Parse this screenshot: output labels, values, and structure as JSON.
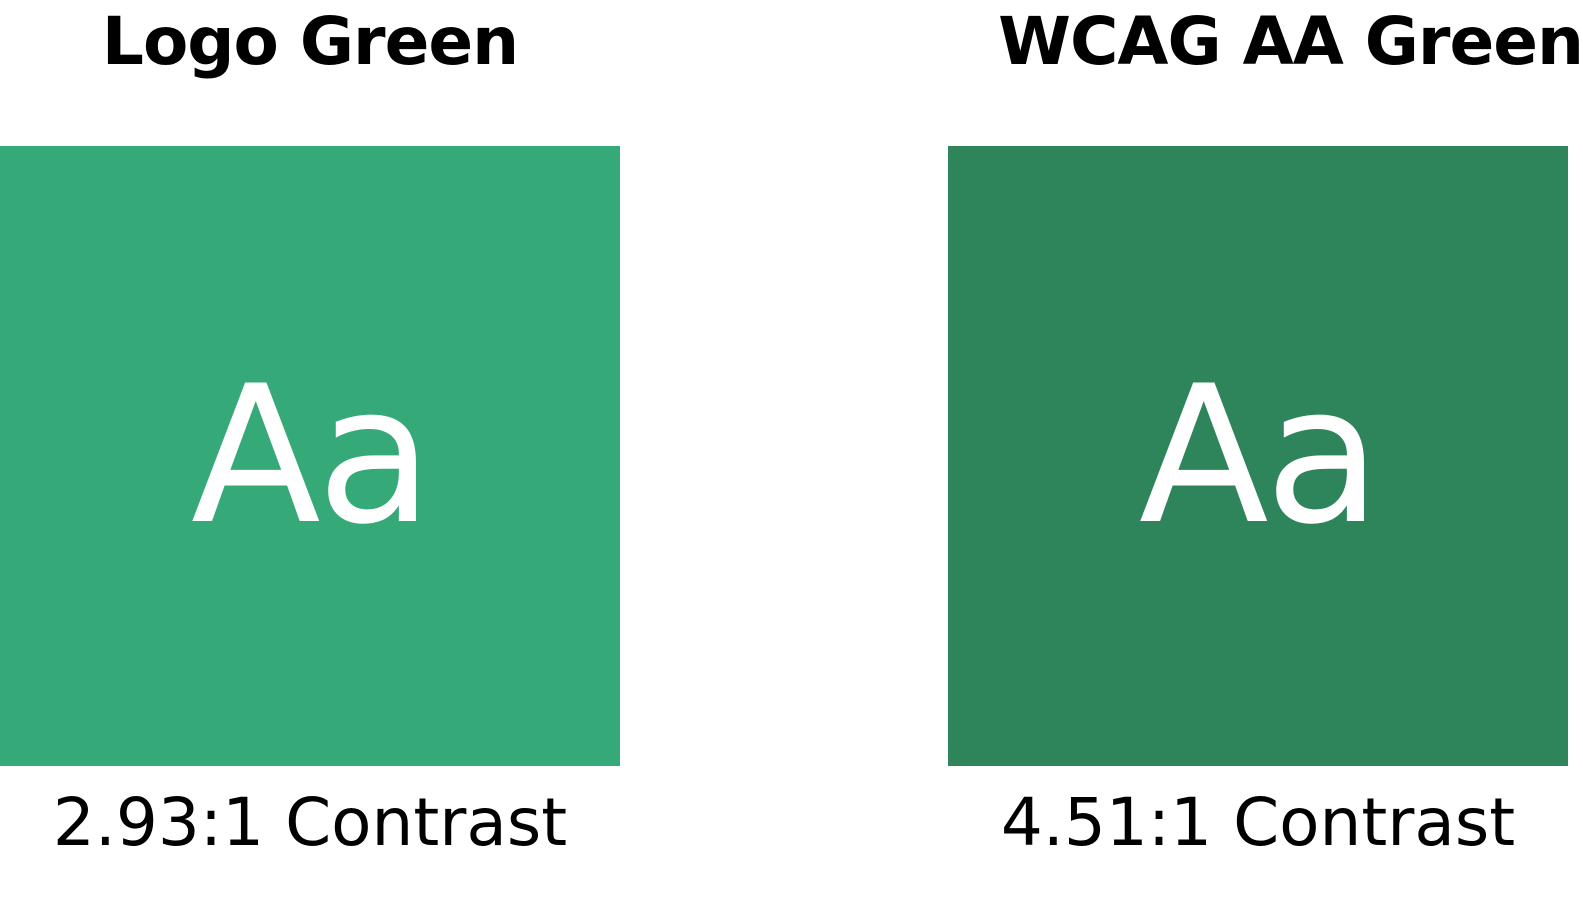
{
  "swatches": [
    {
      "heading": "Logo Green",
      "sample_text": "Aa",
      "contrast": "2.93:1 Contrast",
      "color": "#35AA78"
    },
    {
      "heading": "WCAG AA Green",
      "sample_text": "Aa",
      "contrast": "4.51:1 Contrast",
      "color": "#2E855C"
    }
  ],
  "text_color": "#FFFFFF"
}
